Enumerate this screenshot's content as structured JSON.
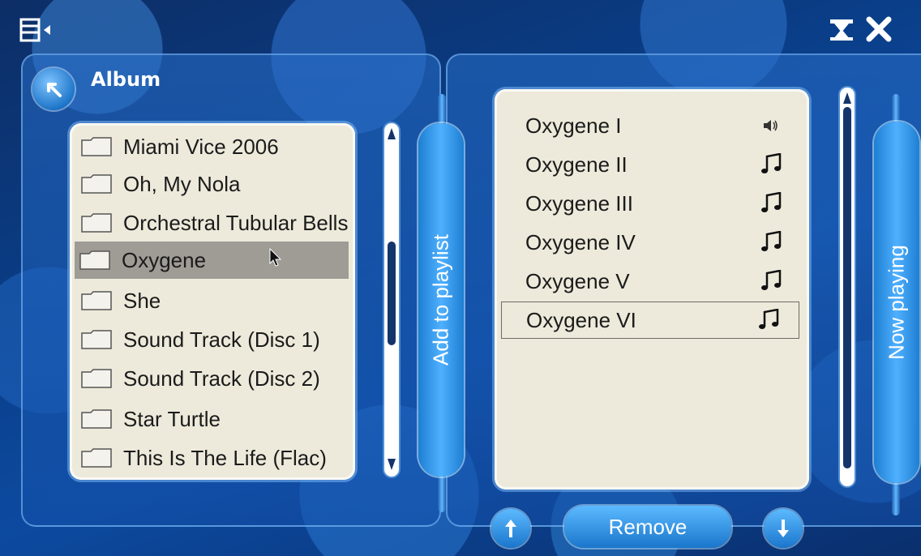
{
  "header": {
    "menu_icon": "menu-icon",
    "minimize_icon": "minimize-icon",
    "close_icon": "close-icon"
  },
  "left": {
    "title": "Album",
    "back_icon": "back-arrow-icon",
    "albums": [
      {
        "label": "Miami Vice 2006"
      },
      {
        "label": "Oh, My Nola"
      },
      {
        "label": "Orchestral Tubular Bells"
      },
      {
        "label": "Oxygene",
        "selected": true
      },
      {
        "label": "She"
      },
      {
        "label": "Sound Track (Disc 1)"
      },
      {
        "label": "Sound Track (Disc 2)"
      },
      {
        "label": "Star Turtle"
      },
      {
        "label": "This Is The Life (Flac)"
      }
    ],
    "add_to_playlist_label": "Add to playlist"
  },
  "right": {
    "tracks": [
      {
        "label": "Oxygene I",
        "icon": "speaker-icon"
      },
      {
        "label": "Oxygene II",
        "icon": "music-note-icon"
      },
      {
        "label": "Oxygene III",
        "icon": "music-note-icon"
      },
      {
        "label": "Oxygene IV",
        "icon": "music-note-icon"
      },
      {
        "label": "Oxygene V",
        "icon": "music-note-icon"
      },
      {
        "label": "Oxygene VI",
        "icon": "music-note-icon",
        "focused": true
      }
    ],
    "now_playing_label": "Now playing",
    "remove_label": "Remove"
  },
  "colors": {
    "panel_bg": "#edeadb",
    "selected_row": "#9f9c96",
    "accent": "#2f8ee6",
    "background": "#0c4aa0"
  }
}
